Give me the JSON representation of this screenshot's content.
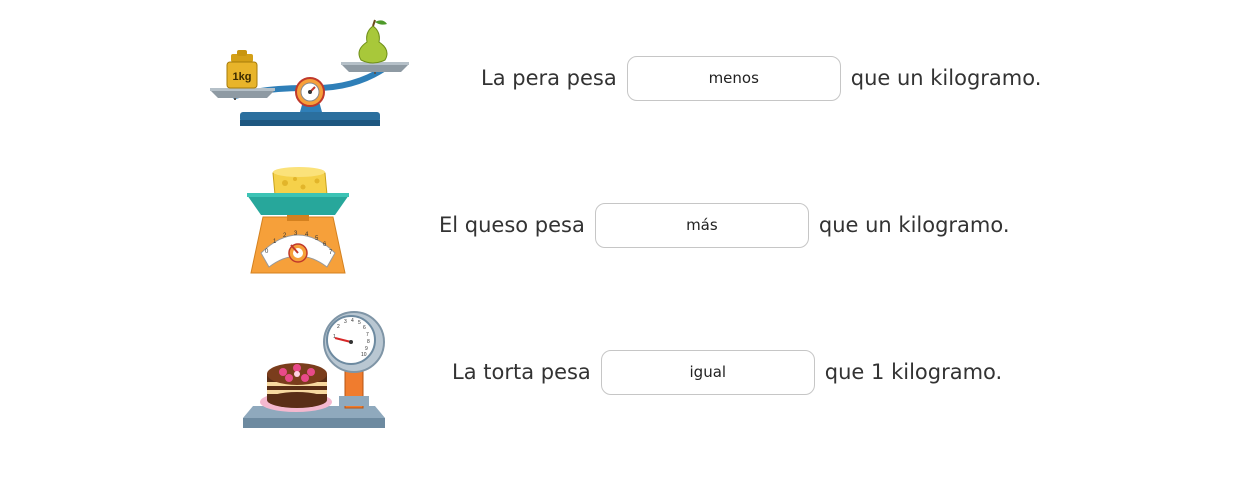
{
  "rows": [
    {
      "prefix": "La pera pesa",
      "answer": "menos",
      "suffix": "que un kilogramo.",
      "illustration": "balance-scale-pear-vs-1kg-weight",
      "weight_label": "1kg"
    },
    {
      "prefix": "El queso pesa",
      "answer": "más",
      "suffix": "que un kilogramo.",
      "illustration": "kitchen-scale-cheese",
      "dial_numbers": [
        "0",
        "1",
        "2",
        "3",
        "4",
        "5",
        "6",
        "7"
      ]
    },
    {
      "prefix": "La torta pesa",
      "answer": "igual",
      "suffix": "que 1 kilogramo.",
      "illustration": "platform-scale-cake",
      "dial_numbers": [
        "1",
        "2",
        "3",
        "4",
        "5",
        "6",
        "7",
        "8",
        "9",
        "10"
      ]
    }
  ],
  "colors": {
    "text": "#333333",
    "box_border": "#c6c6c6",
    "scale_blue": "#2f7fb8",
    "scale_orange": "#f6a03a",
    "scale_teal": "#27a79b"
  }
}
